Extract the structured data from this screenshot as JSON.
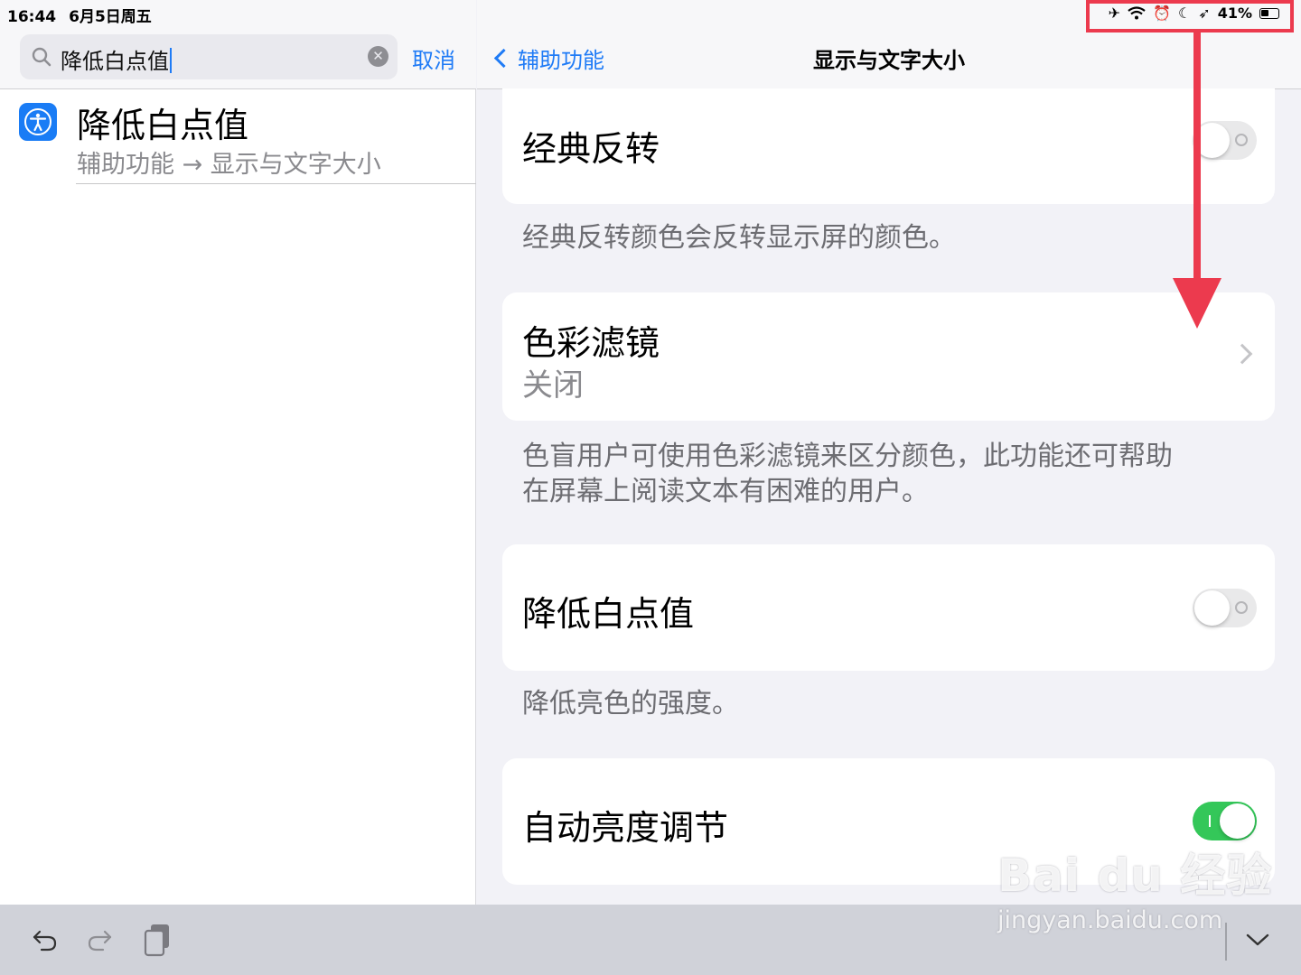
{
  "status_bar": {
    "time": "16:44",
    "date": "6月5日周五",
    "battery": "41%"
  },
  "search": {
    "query": "降低白点值",
    "cancel_label": "取消"
  },
  "result": {
    "title": "降低白点值",
    "path": "辅助功能 → 显示与文字大小"
  },
  "nav": {
    "back_label": "辅助功能",
    "title": "显示与文字大小"
  },
  "settings": {
    "classic_invert": {
      "label": "经典反转",
      "enabled": false,
      "footer": "经典反转颜色会反转显示屏的颜色。"
    },
    "color_filters": {
      "label": "色彩滤镜",
      "value": "关闭",
      "footer_line1": "色盲用户可使用色彩滤镜来区分颜色，此功能还可帮助",
      "footer_line2": "在屏幕上阅读文本有困难的用户。"
    },
    "reduce_white_point": {
      "label": "降低白点值",
      "enabled": false,
      "footer": "降低亮色的强度。"
    },
    "auto_brightness": {
      "label": "自动亮度调节",
      "enabled": true
    }
  },
  "watermark": {
    "logo": "Bai du 经验",
    "url": "jingyan.baidu.com"
  },
  "colors": {
    "accent": "#1f7bf6",
    "toggle_on": "#34c759",
    "highlight": "#ec3a4e"
  }
}
